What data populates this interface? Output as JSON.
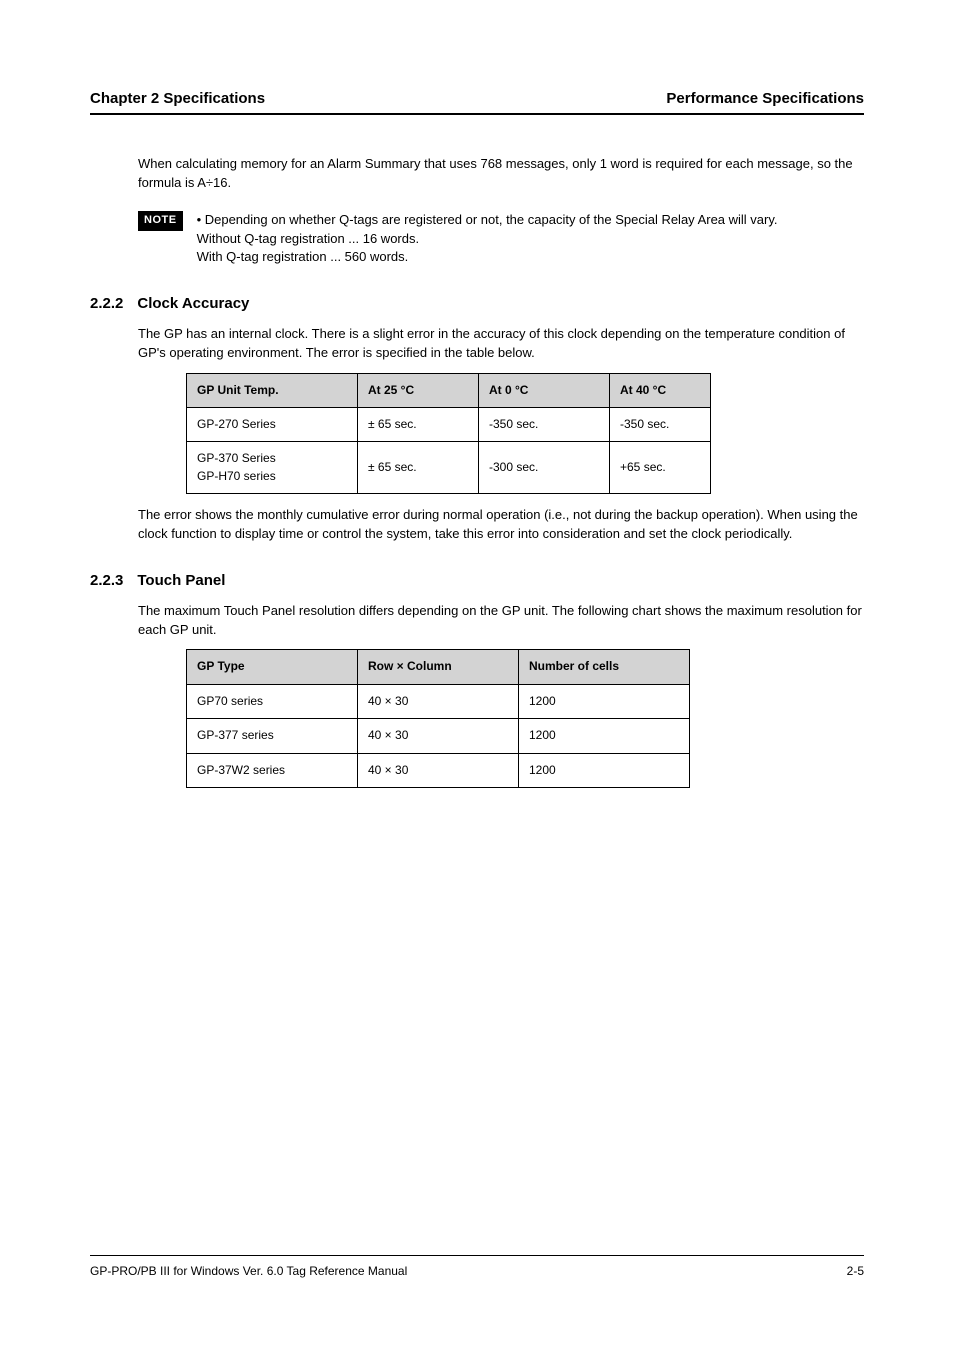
{
  "header": {
    "left": "Chapter 2 Specifications",
    "right": "Performance Specifications"
  },
  "intro_para": "When calculating memory for an Alarm Summary that uses 768 messages, only 1 word is required for each message, so the formula is A÷16.",
  "note": {
    "label": "NOTE",
    "lines": [
      "• Depending on whether Q-tags are registered or not, the capacity of the Special Relay Area will vary.",
      "Without Q-tag registration ... 16 words.",
      "With Q-tag registration ... 560 words."
    ]
  },
  "section1": {
    "number": "2.2.2",
    "title": "Clock Accuracy",
    "para": "The GP has an internal clock. There is a slight error in the accuracy of this clock depending on the temperature condition of GP's operating environment. The error is specified in the table below.",
    "table": {
      "headers": [
        "GP Unit Temp.",
        "At 25 °C",
        "At 0 °C",
        "At 40 °C"
      ],
      "rows": [
        {
          "label": "GP-270 Series",
          "c25": "± 65 sec.",
          "c0": "-350 sec.",
          "c40": "-350 sec."
        },
        {
          "label": "GP-370 Series\nGP-H70 series",
          "c25": "± 65 sec.",
          "c0": "-300 sec.",
          "c40": "+65 sec."
        }
      ]
    },
    "footnote": "The error shows the monthly cumulative error during normal operation (i.e., not during the backup operation). When using the clock function to display time or control the system, take this error into consideration and set the clock periodically."
  },
  "section2": {
    "number": "2.2.3",
    "title": "Touch Panel",
    "para1": "The maximum Touch Panel resolution differs depending on the GP unit. The following chart shows the maximum resolution for each GP unit.",
    "table": {
      "headers": [
        "GP Type",
        "Row × Column",
        "Number of cells"
      ],
      "rows": [
        {
          "type": "GP70 series",
          "rc": "40 × 30",
          "cells": "1200"
        },
        {
          "type": "GP-377 series",
          "rc": "40 × 30",
          "cells": "1200"
        },
        {
          "type": "GP-37W2 series",
          "rc": "40 × 30",
          "cells": "1200"
        }
      ]
    }
  },
  "footer": {
    "left": "GP-PRO/PB III for Windows Ver. 6.0 Tag Reference Manual",
    "right": "2-5"
  }
}
